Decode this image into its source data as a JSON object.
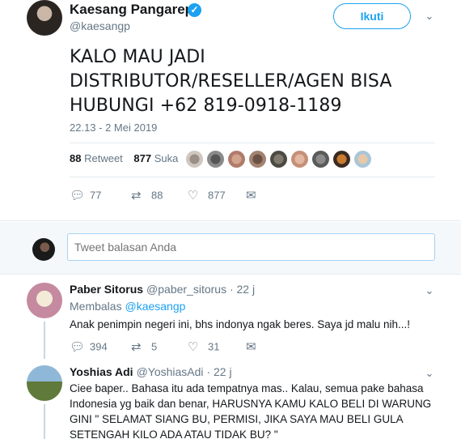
{
  "main_tweet": {
    "display_name": "Kaesang Pangarep",
    "username": "@kaesangp",
    "follow_label": "Ikuti",
    "text": "KALO MAU JADI DISTRIBUTOR/RESELLER/AGEN BISA HUBUNGI +62 819-0918-1189",
    "timestamp": "22.13 - 2 Mei 2019",
    "retweets_count": "88",
    "retweets_label": "Retweet",
    "likes_count": "877",
    "likes_label": "Suka",
    "actions": {
      "reply": "77",
      "retweet": "88",
      "like": "877"
    },
    "icons": [
      "verified-icon",
      "chevron-down-icon",
      "reply-icon",
      "retweet-icon",
      "heart-icon",
      "message-icon"
    ]
  },
  "reply_box": {
    "placeholder": "Tweet balasan Anda"
  },
  "replies": [
    {
      "display_name": "Paber Sitorus",
      "meta": "@paber_sitorus · 22 j",
      "replying_label": "Membalas",
      "replying_to": "@kaesangp",
      "text": "Anak penimpin negeri ini, bhs indonya ngak beres. Saya jd malu nih...!",
      "actions": {
        "reply": "394",
        "retweet": "5",
        "like": "31"
      }
    },
    {
      "display_name": "Yoshias Adi",
      "meta": "@YoshiasAdi · 22 j",
      "text": "Ciee baper.. Bahasa itu ada tempatnya mas.. Kalau, semua pake bahasa Indonesia yg baik dan benar, HARUSNYA KAMU KALO BELI DI WARUNG GINI \" SELAMAT SIANG BU, PERMISI, JIKA SAYA MAU BELI GULA SETENGAH KILO ADA ATAU TIDAK BU? \""
    }
  ],
  "colors": {
    "accent": "#1da1f2",
    "muted": "#657786",
    "text": "#14171a",
    "reply_bg": "#f5f8fa"
  }
}
